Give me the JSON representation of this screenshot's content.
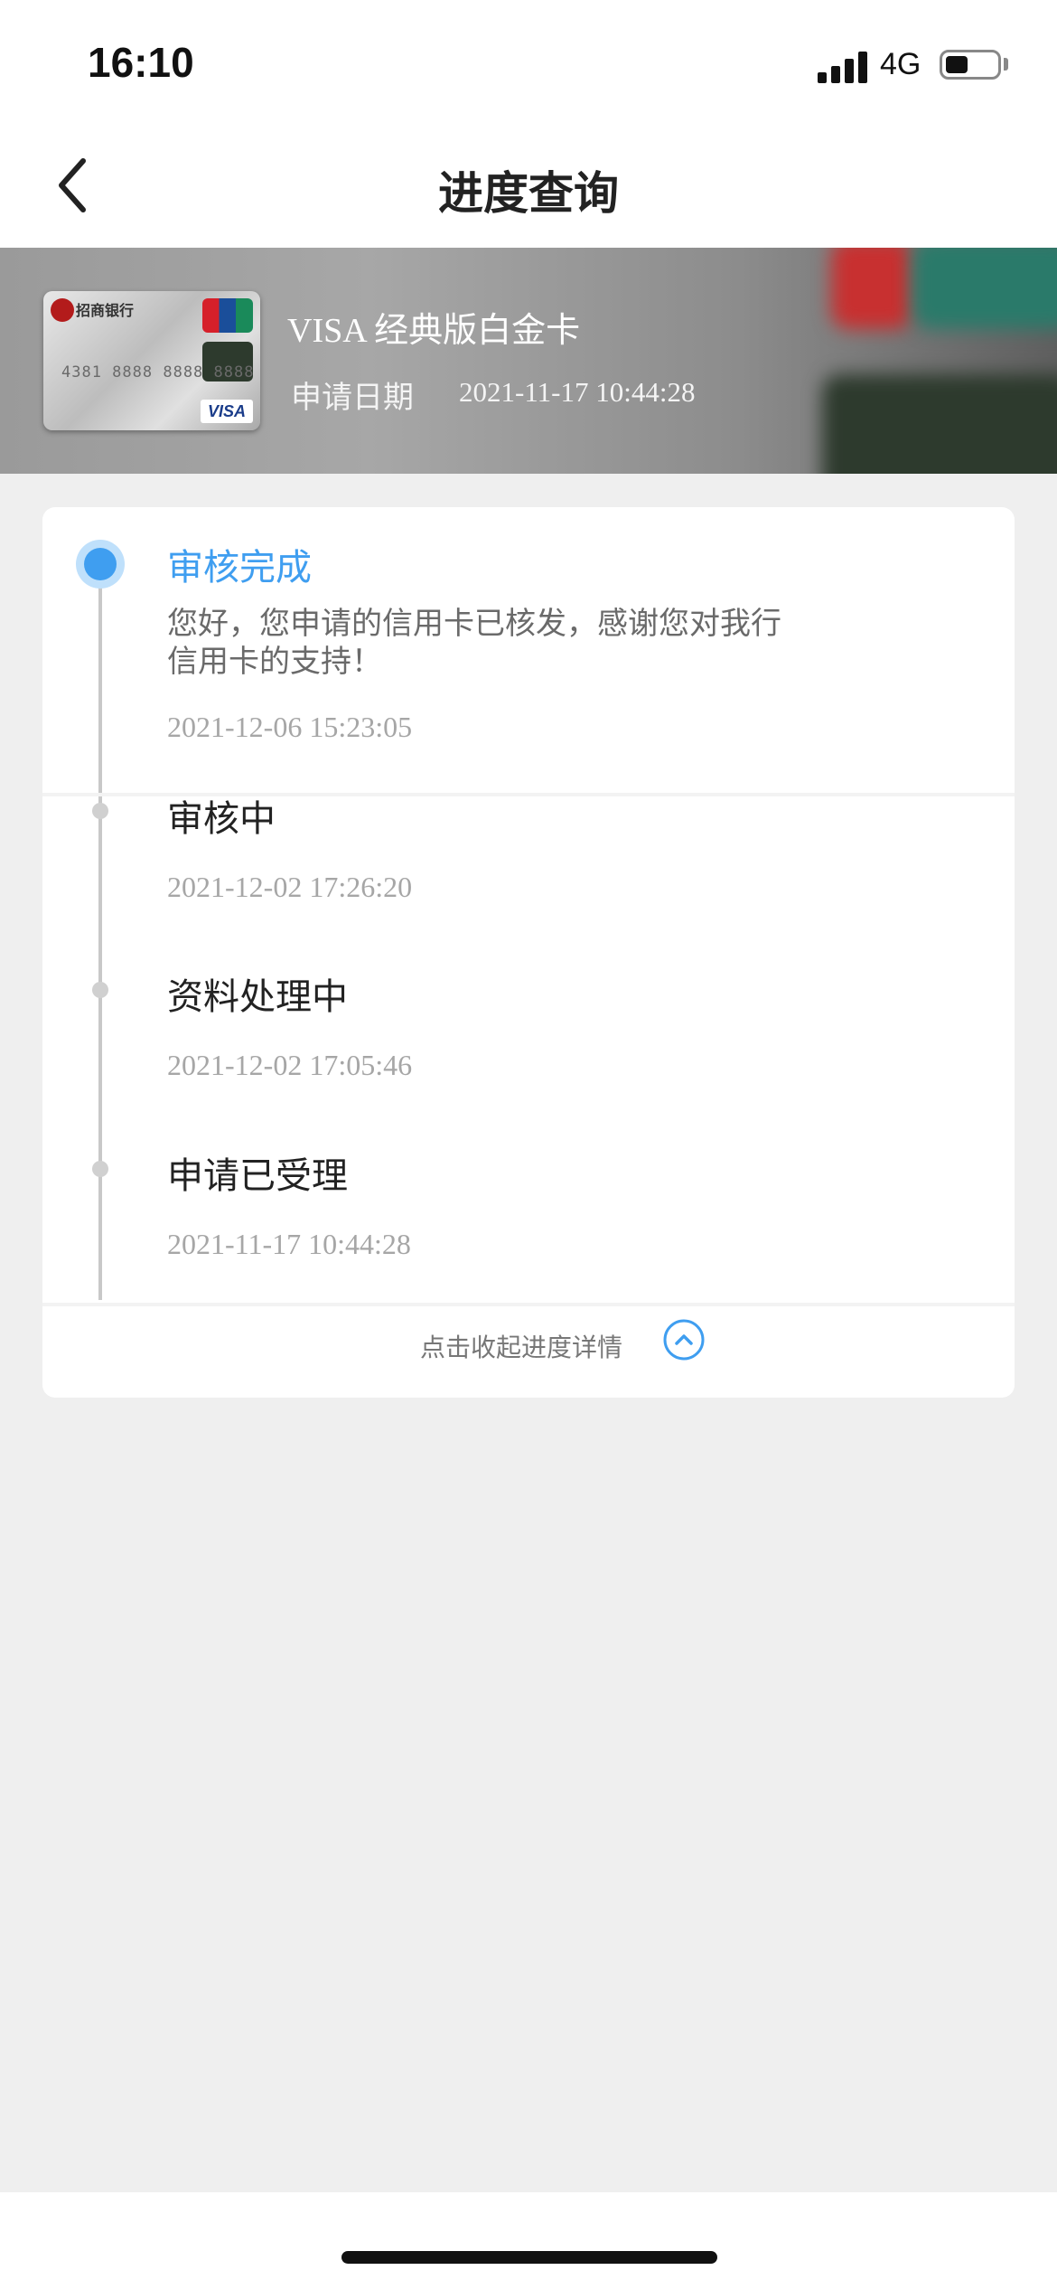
{
  "status_bar": {
    "time": "16:10",
    "network": "4G",
    "battery_level": 0.45
  },
  "nav": {
    "title": "进度查询",
    "back_icon": "chevron-left-icon"
  },
  "card": {
    "name": "VISA 经典版白金卡",
    "apply_date_label": "申请日期",
    "apply_date": "2021-11-17 10:44:28",
    "image": {
      "bank_name": "招商银行",
      "number": "4381 8888 8888 8888",
      "brand": "VISA"
    }
  },
  "progress": {
    "steps": [
      {
        "title": "审核完成",
        "desc": "您好，您申请的信用卡已核发，感谢您对我行信用卡的支持！",
        "time": "2021-12-06 15:23:05",
        "active": true
      },
      {
        "title": "审核中",
        "time": "2021-12-02 17:26:20",
        "active": false
      },
      {
        "title": "资料处理中",
        "time": "2021-12-02 17:05:46",
        "active": false
      },
      {
        "title": "申请已受理",
        "time": "2021-11-17 10:44:28",
        "active": false
      }
    ],
    "collapse_label": "点击收起进度详情",
    "collapse_icon": "chevron-up-circle-icon"
  },
  "colors": {
    "accent": "#3f9ef0",
    "background": "#efefef",
    "timeline": "#c8c8c8"
  }
}
